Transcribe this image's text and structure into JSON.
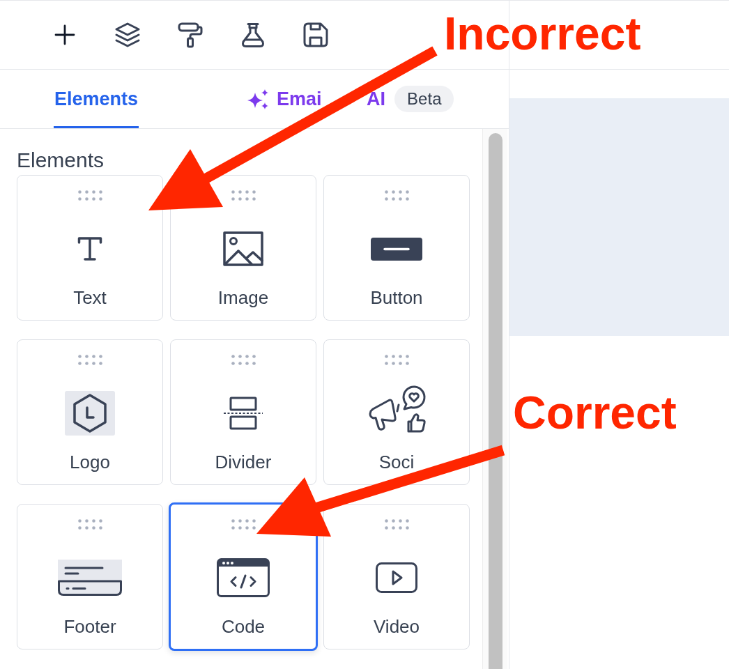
{
  "tabs": [
    {
      "kind": "plain",
      "label": "Elements",
      "selected": true
    },
    {
      "kind": "ai",
      "label": "Emai AI",
      "selected": false,
      "badge": "Beta"
    }
  ],
  "section": {
    "title": "Elements"
  },
  "tiles": [
    {
      "kind": "text",
      "label": "Text",
      "selected": false
    },
    {
      "kind": "image",
      "label": "Image",
      "selected": false
    },
    {
      "kind": "button",
      "label": "Button",
      "selected": false
    },
    {
      "kind": "logo",
      "label": "Logo",
      "selected": false
    },
    {
      "kind": "divider",
      "label": "Divider",
      "selected": false
    },
    {
      "kind": "social",
      "label": "Soci",
      "selected": false
    },
    {
      "kind": "footer",
      "label": "Footer",
      "selected": false
    },
    {
      "kind": "code",
      "label": "Code",
      "selected": true
    },
    {
      "kind": "video",
      "label": "Video",
      "selected": false
    }
  ],
  "annotations": [
    {
      "label": "Incorrect"
    },
    {
      "label": "Correct"
    }
  ]
}
